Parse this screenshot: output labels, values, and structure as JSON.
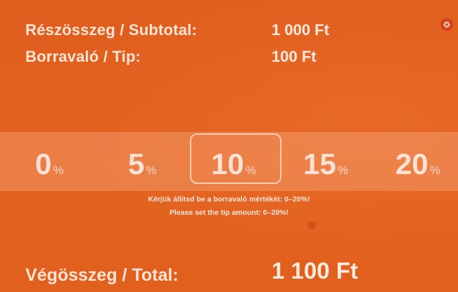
{
  "summary": {
    "subtotal_label": "Részösszeg / Subtotal:",
    "subtotal_value": "1 000 Ft",
    "tip_label": "Borravaló / Tip:",
    "tip_value": "100 Ft"
  },
  "tip_selector": {
    "options": [
      {
        "value": "0",
        "unit": "%"
      },
      {
        "value": "5",
        "unit": "%"
      },
      {
        "value": "10",
        "unit": "%"
      },
      {
        "value": "15",
        "unit": "%"
      },
      {
        "value": "20",
        "unit": "%"
      }
    ],
    "selected": "10"
  },
  "hint": {
    "hu": "Kérjük állítsd be a borravaló mértékét: 0–20%!",
    "en": "Please set the tip amount: 0–20%!"
  },
  "total": {
    "label": "Végösszeg / Total:",
    "value": "1 100 Ft"
  },
  "icons": {
    "settings": "gear-icon"
  },
  "colors": {
    "background": "#e2601f",
    "text": "#fbe4d6",
    "settings_badge": "#d4421c"
  }
}
